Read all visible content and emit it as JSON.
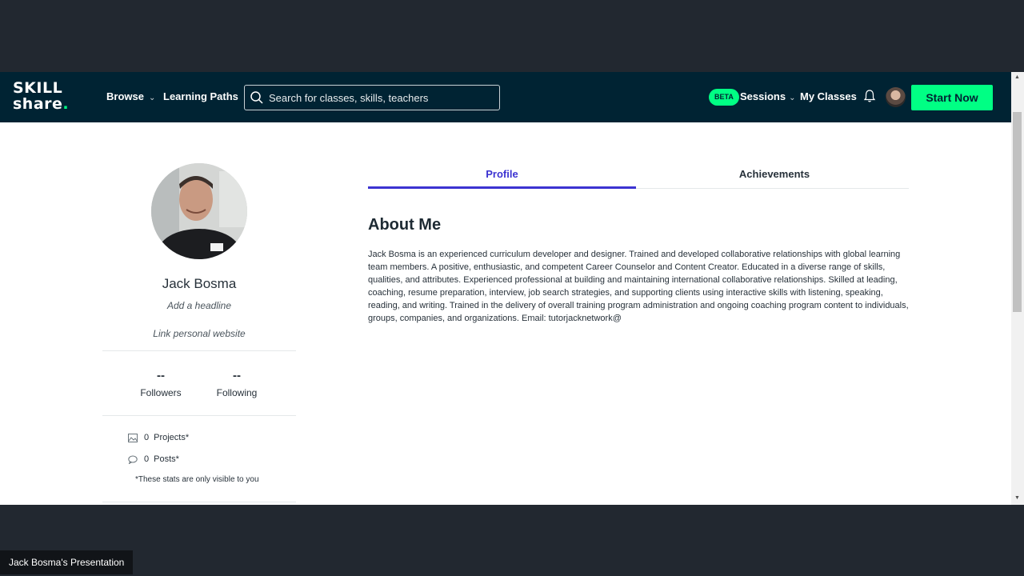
{
  "nav": {
    "logo_line1": "SKILL",
    "logo_line2": "share",
    "logo_dot": ".",
    "browse": "Browse",
    "learning_paths": "Learning Paths",
    "search_placeholder": "Search for classes, skills, teachers",
    "beta": "BETA",
    "sessions": "Sessions",
    "my_classes": "My Classes",
    "start_now": "Start Now"
  },
  "profile": {
    "name": "Jack Bosma",
    "headline": "Add a headline",
    "website": "Link personal website",
    "followers_value": "--",
    "followers_label": "Followers",
    "following_value": "--",
    "following_label": "Following",
    "projects_count": "0",
    "projects_label": "Projects*",
    "posts_count": "0",
    "posts_label": "Posts*",
    "note": "*These stats are only visible to you"
  },
  "tabs": {
    "profile": "Profile",
    "achievements": "Achievements"
  },
  "about": {
    "title": "About Me",
    "text": "Jack Bosma is an experienced curriculum developer and designer. Trained and developed collaborative relationships with global learning team members. A positive, enthusiastic, and competent Career Counselor and Content Creator. Educated in a diverse range of skills, qualities, and attributes. Experienced professional at building and maintaining international collaborative relationships. Skilled at leading, coaching, resume preparation, interview, job search strategies, and supporting clients using interactive skills with listening, speaking, reading, and writing. Trained in the delivery of overall training program administration and ongoing coaching program content to individuals, groups, companies, and organizations. Email: tutorjacknetwork@"
  },
  "presentation_label": "Jack Bosma's Presentation",
  "colors": {
    "nav_bg": "#002333",
    "accent_green": "#00ff84",
    "tab_active": "#3c33d1",
    "page_bg": "#222830"
  }
}
